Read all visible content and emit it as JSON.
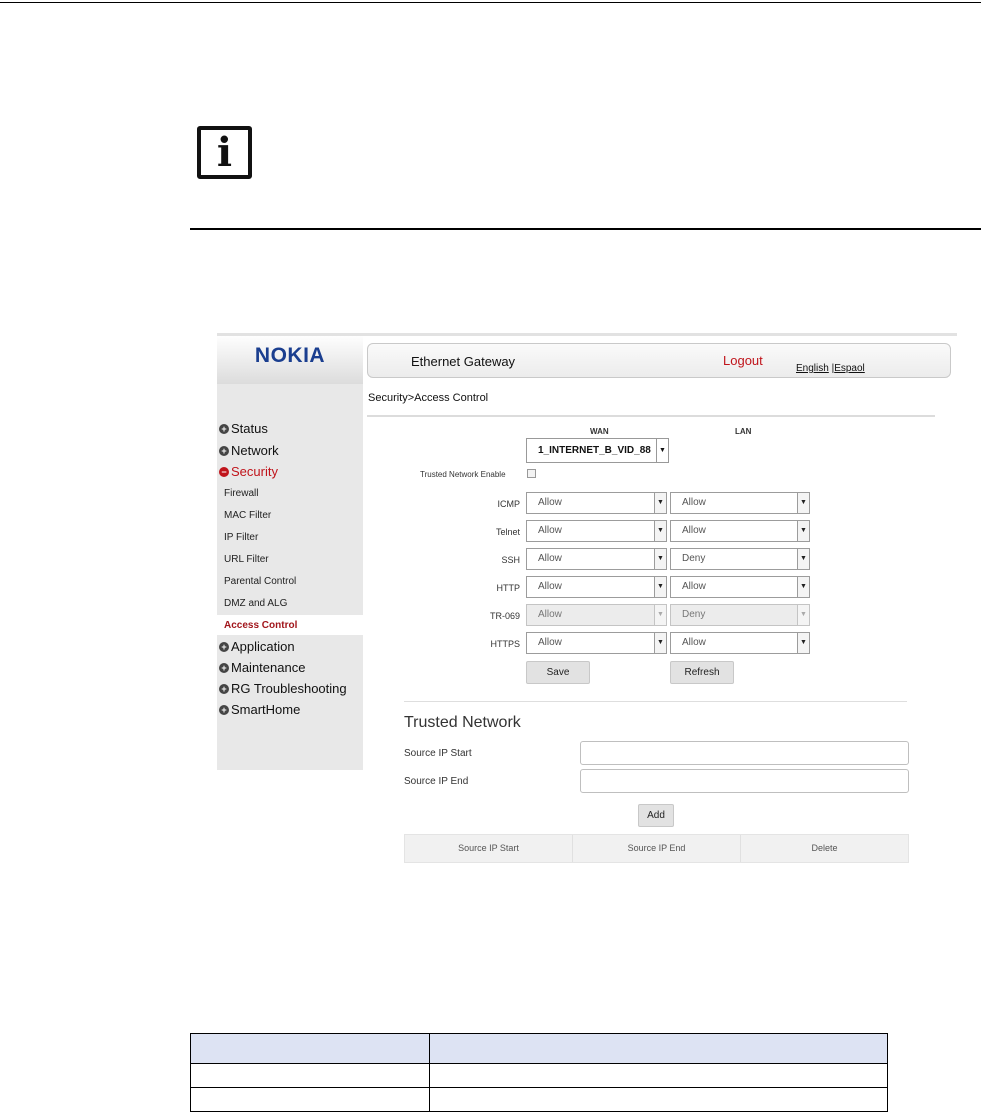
{
  "gateway": {
    "logo": "NOKIA",
    "header_title": "Ethernet Gateway",
    "logout": "Logout",
    "lang_english": "English",
    "lang_sep": " |",
    "lang_spanish": "Espaol",
    "breadcrumb": "Security>Access Control"
  },
  "sidebar": {
    "status": "Status",
    "network": "Network",
    "security": "Security",
    "sub": [
      "Firewall",
      "MAC Filter",
      "IP Filter",
      "URL Filter",
      "Parental Control",
      "DMZ and ALG",
      "Access Control"
    ],
    "application": "Application",
    "maintenance": "Maintenance",
    "rg_troubleshooting": "RG Troubleshooting",
    "smarthome": "SmartHome"
  },
  "access": {
    "wan_header": "WAN",
    "lan_header": "LAN",
    "wan_interface": "1_INTERNET_B_VID_88",
    "trusted_enable_label": "Trusted Network Enable",
    "rows": [
      {
        "service": "ICMP",
        "wan": "Allow",
        "lan": "Allow"
      },
      {
        "service": "Telnet",
        "wan": "Allow",
        "lan": "Allow"
      },
      {
        "service": "SSH",
        "wan": "Allow",
        "lan": "Deny"
      },
      {
        "service": "HTTP",
        "wan": "Allow",
        "lan": "Allow"
      },
      {
        "service": "TR-069",
        "wan": "Allow",
        "lan": "Deny"
      },
      {
        "service": "HTTPS",
        "wan": "Allow",
        "lan": "Allow"
      }
    ],
    "save": "Save",
    "refresh": "Refresh"
  },
  "trusted": {
    "title": "Trusted Network",
    "ip_start_label": "Source IP Start",
    "ip_end_label": "Source IP End",
    "add": "Add",
    "table_headers": [
      "Source IP Start",
      "Source IP End",
      "Delete"
    ]
  },
  "icons": {
    "info": "i",
    "plus": "+",
    "minus": "−",
    "arrow": "▼"
  }
}
